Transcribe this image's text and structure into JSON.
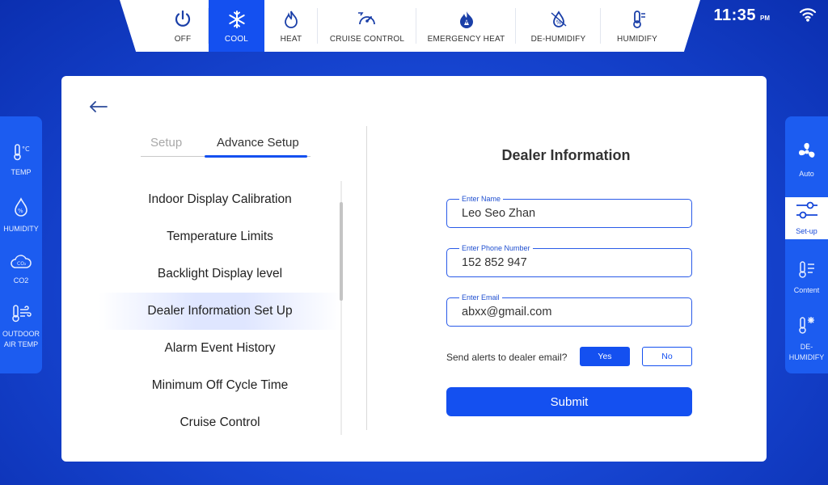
{
  "modes": [
    {
      "label": "OFF",
      "icon": "power-icon"
    },
    {
      "label": "COOL",
      "icon": "snowflake-icon",
      "active": true
    },
    {
      "label": "HEAT",
      "icon": "flame-icon"
    },
    {
      "label": "CRUISE CONTROL",
      "icon": "gauge-icon"
    },
    {
      "label": "EMERGENCY HEAT",
      "icon": "emergency-flame-icon"
    },
    {
      "label": "DE-HUMIDIFY",
      "icon": "dehumidify-icon"
    },
    {
      "label": "HUMIDIFY",
      "icon": "humidify-icon"
    }
  ],
  "clock": {
    "time": "11:35",
    "ampm": "PM"
  },
  "left_sidebar": [
    {
      "label": "TEMP",
      "icon": "thermometer-icon"
    },
    {
      "label": "HUMIDITY",
      "icon": "droplet-icon"
    },
    {
      "label": "CO2",
      "icon": "co2-cloud-icon"
    },
    {
      "label_line1": "OUTDOOR",
      "label_line2": "AIR TEMP",
      "icon": "outdoor-temp-icon"
    }
  ],
  "right_sidebar": [
    {
      "label": "Auto",
      "icon": "fan-icon"
    },
    {
      "label": "Set-up",
      "icon": "sliders-icon",
      "active": true
    },
    {
      "label": "Content",
      "icon": "thermometer-list-icon"
    },
    {
      "label_line1": "DE-",
      "label_line2": "HUMIDIFY",
      "icon": "dehumidify-thermo-icon"
    }
  ],
  "tabs": {
    "setup": "Setup",
    "advance": "Advance Setup"
  },
  "menu_items": [
    "Indoor Display Calibration",
    "Temperature Limits",
    "Backlight Display level",
    "Dealer Information Set Up",
    "Alarm Event History",
    "Minimum Off Cycle Time",
    "Cruise Control"
  ],
  "dealer": {
    "title": "Dealer Information",
    "name_label": "Enter Name",
    "name_value": "Leo Seo Zhan",
    "phone_label": "Enter Phone Number",
    "phone_value": "152 852 947",
    "email_label": "Enter Email",
    "email_value": "abxx@gmail.com",
    "alerts_question": "Send alerts to dealer email?",
    "yes_label": "Yes",
    "no_label": "No",
    "submit_label": "Submit"
  },
  "colors": {
    "accent": "#1450f0",
    "background": "#1848d6",
    "panel": "#1c5cf0"
  }
}
